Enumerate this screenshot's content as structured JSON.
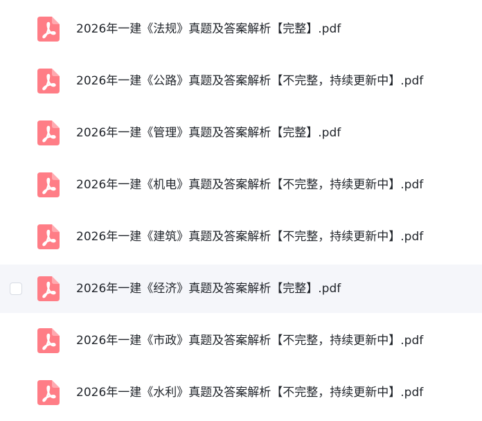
{
  "files": [
    {
      "name": "2026年一建《法规》真题及答案解析【完整】.pdf",
      "icon": "pdf-file-icon"
    },
    {
      "name": "2026年一建《公路》真题及答案解析【不完整，持续更新中】.pdf",
      "icon": "pdf-file-icon"
    },
    {
      "name": "2026年一建《管理》真题及答案解析【完整】.pdf",
      "icon": "pdf-file-icon"
    },
    {
      "name": "2026年一建《机电》真题及答案解析【不完整，持续更新中】.pdf",
      "icon": "pdf-file-icon"
    },
    {
      "name": "2026年一建《建筑》真题及答案解析【不完整，持续更新中】.pdf",
      "icon": "pdf-file-icon"
    },
    {
      "name": "2026年一建《经济》真题及答案解析【完整】.pdf",
      "icon": "pdf-file-icon"
    },
    {
      "name": "2026年一建《市政》真题及答案解析【不完整，持续更新中】.pdf",
      "icon": "pdf-file-icon"
    },
    {
      "name": "2026年一建《水利》真题及答案解析【不完整，持续更新中】.pdf",
      "icon": "pdf-file-icon"
    }
  ],
  "hovered_index": 5,
  "colors": {
    "pdf_icon": "#ff7d86",
    "hover_background": "#f5f6fa",
    "text": "#1f2329"
  }
}
